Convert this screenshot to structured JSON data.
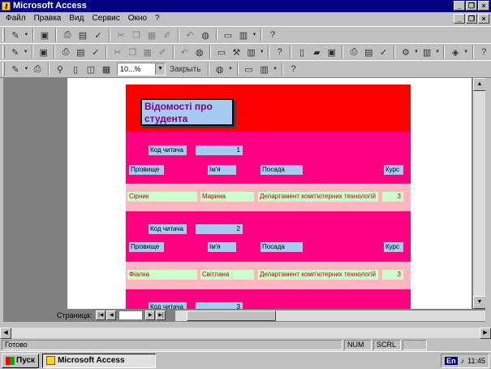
{
  "window": {
    "title": "Microsoft Access"
  },
  "menu": [
    "Файл",
    "Правка",
    "Вид",
    "Сервис",
    "Окно",
    "?"
  ],
  "toolbar3": {
    "zoom": "10...%",
    "close_label": "Закрыть"
  },
  "report": {
    "title": "Відомості про студента",
    "records": [
      {
        "code_label": "Код читача",
        "code_value": "1",
        "headers": {
          "surname": "Прізвище",
          "name": "Ім'я",
          "position": "Посада",
          "course": "Курс"
        },
        "values": {
          "surname": "Сірник",
          "name": "Марина",
          "position": "Департамент комп'ютерних технологій",
          "course": "3"
        }
      },
      {
        "code_label": "Код читача",
        "code_value": "2",
        "headers": {
          "surname": "Прізвище",
          "name": "Ім'я",
          "position": "Посада",
          "course": "Курс"
        },
        "values": {
          "surname": "Фіалка",
          "name": "Світлана",
          "position": "Департамент комп'ютерних технологій",
          "course": "3"
        }
      },
      {
        "code_label": "Код читача",
        "code_value": "3"
      }
    ]
  },
  "navigation": {
    "label": "Страница:"
  },
  "status": {
    "ready": "Готово",
    "num": "NUM",
    "scrl": "SCRL"
  },
  "taskbar": {
    "start": "Пуск",
    "app_button": "Microsoft Access",
    "lang": "En",
    "time": "11:45"
  }
}
